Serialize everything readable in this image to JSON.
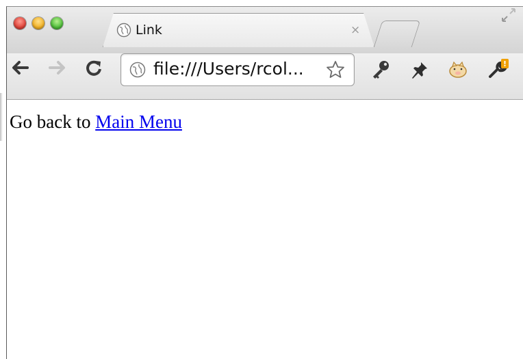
{
  "tab": {
    "title": "Link",
    "close_glyph": "×",
    "icon": "globe-icon"
  },
  "toolbar": {
    "back_icon": "back-arrow-icon",
    "forward_icon": "forward-arrow-icon",
    "reload_icon": "reload-icon",
    "address": "file:///Users/rcol...",
    "star_icon": "star-icon",
    "extensions": [
      "key-icon",
      "pushpin-icon",
      "piggy-bank-icon",
      "wrench-icon"
    ],
    "wrench_badge": "!"
  },
  "page": {
    "prefix_text": "Go back to ",
    "link_text": "Main Menu"
  },
  "colors": {
    "link": "#0000ee",
    "close_light": "#e0443a",
    "minimize_light": "#f2b226",
    "maximize_light": "#4fbd3a",
    "badge": "#f0a000"
  }
}
